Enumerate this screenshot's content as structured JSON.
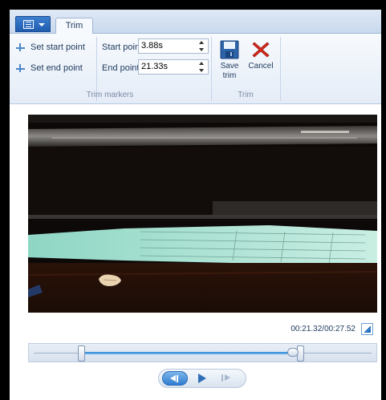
{
  "ribbon": {
    "tab_label": "Trim",
    "set_start_label": "Set start point",
    "set_end_label": "Set end point",
    "start_point_label": "Start point:",
    "start_point_value": "3.88s",
    "end_point_label": "End point:",
    "end_point_value": "21.33s",
    "group_trim_markers": "Trim markers",
    "save_trim_label_1": "Save",
    "save_trim_label_2": "trim",
    "cancel_label": "Cancel",
    "group_trim": "Trim"
  },
  "player": {
    "timecode": "00:21.32/00:27.52",
    "trim_start_fraction": 0.141,
    "trim_end_fraction": 0.775,
    "playhead_fraction": 0.775
  },
  "icons": {
    "app_menu": "document-menu-icon",
    "set_start": "marker-start-icon",
    "set_end": "marker-end-icon",
    "save": "floppy-disk-icon",
    "cancel": "red-x-icon",
    "expand": "expand-icon",
    "previous_frame": "previous-frame-icon",
    "play": "play-icon",
    "next_frame": "next-frame-icon"
  },
  "colors": {
    "accent": "#2f7dd0",
    "cancel_red": "#d42a1e",
    "ribbon_bg": "#e4ecf7"
  }
}
